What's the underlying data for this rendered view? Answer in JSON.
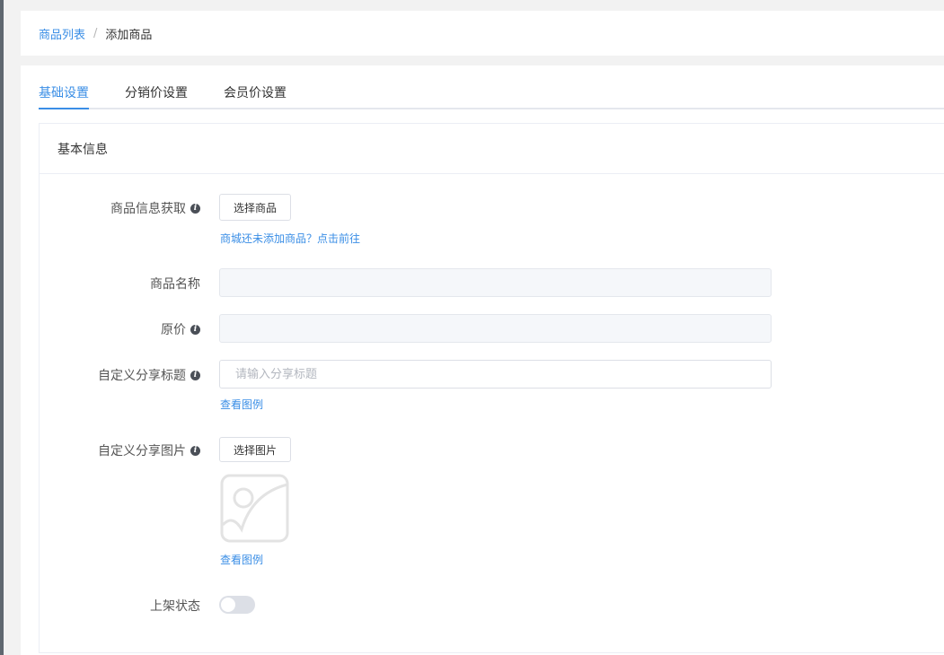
{
  "breadcrumb": {
    "parent": "商品列表",
    "separator": "/",
    "current": "添加商品"
  },
  "tabs": [
    {
      "label": "基础设置",
      "active": true
    },
    {
      "label": "分销价设置",
      "active": false
    },
    {
      "label": "会员价设置",
      "active": false
    }
  ],
  "panel": {
    "title": "基本信息",
    "product_source": {
      "label": "商品信息获取",
      "button": "选择商品",
      "hint_link": "商城还未添加商品？点击前往"
    },
    "product_name": {
      "label": "商品名称",
      "value": ""
    },
    "original_price": {
      "label": "原价",
      "value": ""
    },
    "share_title": {
      "label": "自定义分享标题",
      "placeholder": "请输入分享标题",
      "value": "",
      "example_link": "查看图例"
    },
    "share_image": {
      "label": "自定义分享图片",
      "button": "选择图片",
      "example_link": "查看图例"
    },
    "listing_status": {
      "label": "上架状态",
      "enabled": false
    }
  },
  "colors": {
    "accent": "#3a8ee6",
    "switch_off": "#dcdfe6",
    "icon": "#4a4f57"
  }
}
